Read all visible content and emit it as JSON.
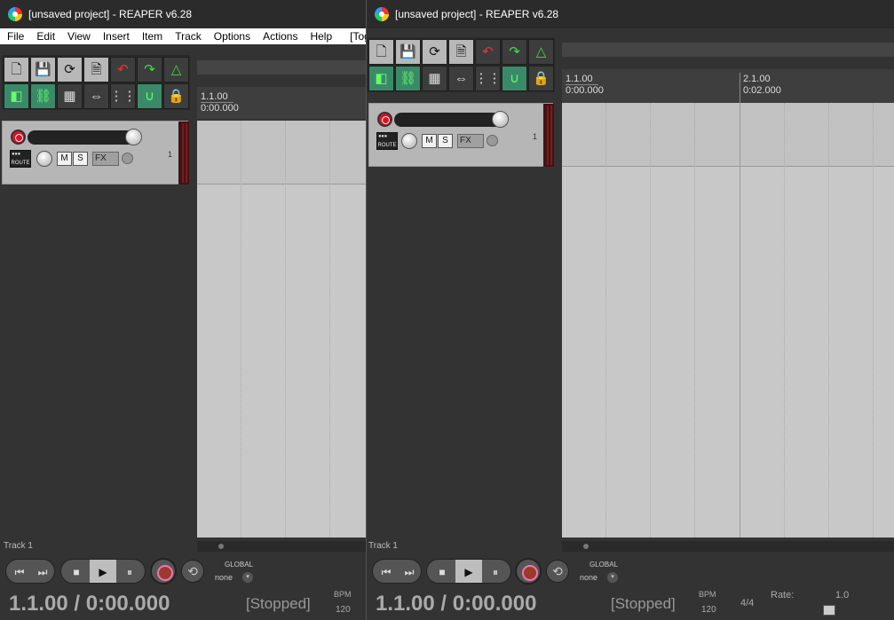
{
  "windows": [
    {
      "title": "[unsaved project] - REAPER v6.28",
      "menu": [
        "File",
        "Edit",
        "View",
        "Insert",
        "Item",
        "Track",
        "Options",
        "Actions",
        "Help",
        "[Tog"
      ],
      "ruler": {
        "markers": [
          {
            "bar": "1.1.00",
            "time": "0:00.000"
          }
        ]
      },
      "track": {
        "number": "1",
        "route_label": "ROUTE",
        "mute": "M",
        "solo": "S",
        "fx": "FX"
      },
      "track_name_footer": "Track 1",
      "transport": {
        "global_label": "GLOBAL",
        "automation_mode": "none",
        "position": "1.1.00 / 0:00.000",
        "status": "[Stopped]",
        "bpm_label": "BPM",
        "bpm": "120"
      }
    },
    {
      "title": "[unsaved project] - REAPER v6.28",
      "ruler": {
        "markers": [
          {
            "bar": "1.1.00",
            "time": "0:00.000"
          },
          {
            "bar": "2.1.00",
            "time": "0:02.000"
          }
        ]
      },
      "track": {
        "number": "1",
        "route_label": "ROUTE",
        "mute": "M",
        "solo": "S",
        "fx": "FX"
      },
      "track_name_footer": "Track 1",
      "transport": {
        "global_label": "GLOBAL",
        "automation_mode": "none",
        "position": "1.1.00 / 0:00.000",
        "status": "[Stopped]",
        "bpm_label": "BPM",
        "bpm": "120",
        "time_signature": "4/4",
        "rate_label": "Rate:",
        "rate_value": "1.0"
      }
    }
  ],
  "colors": {
    "accent_green": "#3a8a6a",
    "record_red": "#dd1122",
    "arrange_bg": "#c8c8c8"
  },
  "toolbar_icons": [
    "new-project-icon",
    "open-project-icon",
    "save-project-icon",
    "project-settings-icon",
    "undo-icon",
    "redo-icon",
    "metronome-icon",
    "grid-snap-icon",
    "ripple-edit-icon",
    "item-grouping-icon",
    "envelope-points-icon",
    "crossfade-icon",
    "lock-icon"
  ]
}
